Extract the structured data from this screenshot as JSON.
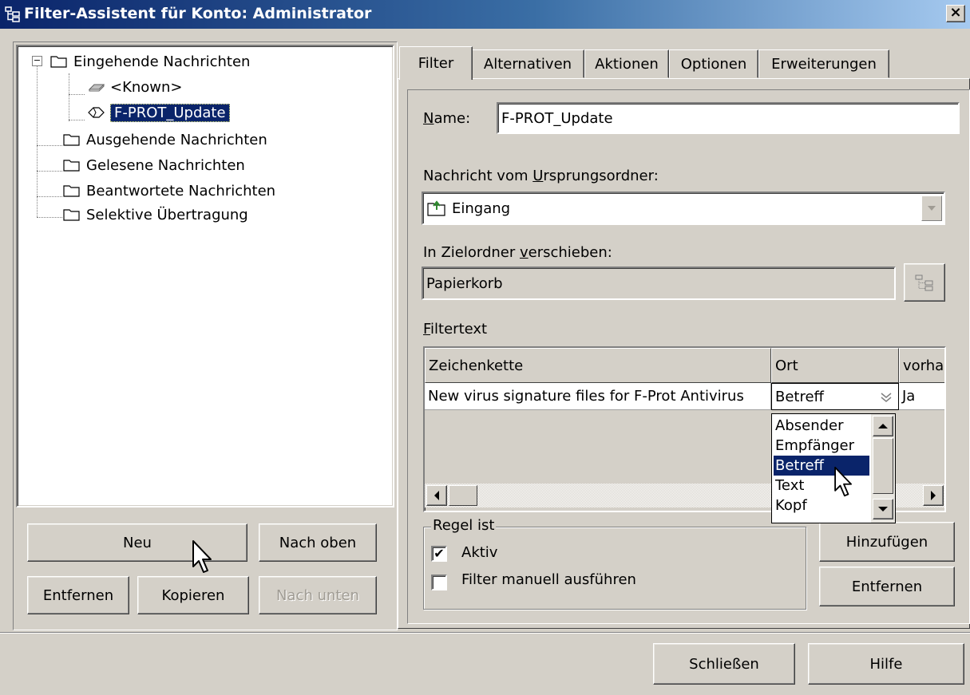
{
  "window": {
    "title": "Filter-Assistent für Konto: Administrator",
    "close_label": "×"
  },
  "tree": {
    "items": [
      {
        "label": "Eingehende Nachrichten",
        "icon": "folder-icon",
        "expander": "−"
      },
      {
        "label": "<Known>",
        "icon": "filter-disabled-icon"
      },
      {
        "label": "F-PROT_Update",
        "icon": "filter-icon",
        "selected": true
      },
      {
        "label": "Ausgehende Nachrichten",
        "icon": "folder-icon"
      },
      {
        "label": "Gelesene Nachrichten",
        "icon": "folder-icon"
      },
      {
        "label": "Beantwortete Nachrichten",
        "icon": "folder-icon"
      },
      {
        "label": "Selektive Übertragung",
        "icon": "folder-icon"
      }
    ]
  },
  "left_buttons": {
    "new": "Neu",
    "up": "Nach oben",
    "remove": "Entfernen",
    "copy": "Kopieren",
    "down": "Nach unten"
  },
  "tabs": [
    {
      "label": "Filter",
      "active": true
    },
    {
      "label": "Alternativen"
    },
    {
      "label": "Aktionen"
    },
    {
      "label": "Optionen"
    },
    {
      "label": "Erweiterungen"
    }
  ],
  "filter": {
    "name_label_first": "N",
    "name_label_rest": "ame:",
    "name_value": "F-PROT_Update",
    "source_label_pre": "Nachricht vom ",
    "source_label_ul": "U",
    "source_label_post": "rsprungsordner:",
    "source_value": "Eingang",
    "target_label_pre": "In Zielordner ",
    "target_label_ul": "v",
    "target_label_post": "erschieben:",
    "target_value": "Papierkorb",
    "filtertext_label_ul": "F",
    "filtertext_label_rest": "iltertext"
  },
  "grid": {
    "headers": [
      "Zeichenkette",
      "Ort",
      "vorha"
    ],
    "rows": [
      [
        "New virus signature files for F-Prot Antivirus",
        "Betreff",
        "Ja"
      ]
    ]
  },
  "dropdown_options": [
    "Absender",
    "Empfänger",
    "Betreff",
    "Text",
    "Kopf"
  ],
  "dropdown_selected": "Betreff",
  "rule": {
    "legend": "Regel ist",
    "active_label": "Aktiv",
    "active_checked": true,
    "manual_label": "Filter manuell ausführen",
    "manual_checked": false
  },
  "right_buttons": {
    "add": "Hinzufügen",
    "remove": "Entfernen"
  },
  "footer": {
    "close": "Schließen",
    "help": "Hilfe"
  }
}
